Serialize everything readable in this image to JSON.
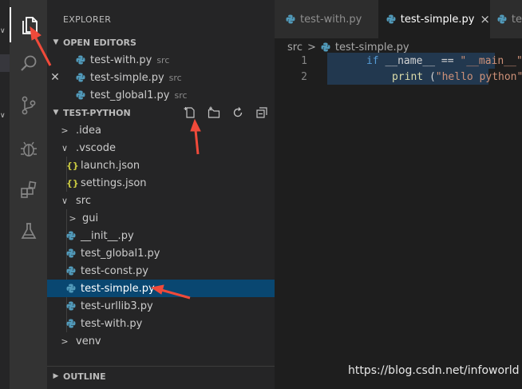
{
  "explorer": {
    "title": "EXPLORER",
    "open_editors": {
      "label": "OPEN EDITORS",
      "items": [
        {
          "name": "test-with.py",
          "folder": "src"
        },
        {
          "name": "test-simple.py",
          "folder": "src"
        },
        {
          "name": "test_global1.py",
          "folder": "src"
        }
      ]
    },
    "project": {
      "label": "TEST-PYTHON",
      "tree": {
        "idea": ".idea",
        "vscode": ".vscode",
        "launch": "launch.json",
        "settings": "settings.json",
        "src": "src",
        "gui": "gui",
        "init": "__init__.py",
        "global1": "test_global1.py",
        "const": "test-const.py",
        "simple": "test-simple.py",
        "urllib3": "test-urllib3.py",
        "with": "test-with.py",
        "venv": "venv"
      }
    },
    "outline": "OUTLINE"
  },
  "json_glyph": "{}",
  "tabs": [
    {
      "label": "test-with.py"
    },
    {
      "label": "test-simple.py",
      "close": "×"
    },
    {
      "label": "te"
    }
  ],
  "breadcrumb": {
    "folder": "src",
    "separator": ">",
    "file": "test-simple.py"
  },
  "code": {
    "line1_no": "1",
    "line2_no": "2",
    "l1_if": "if",
    "l1_name": "__name__",
    "l1_eq": "==",
    "l1_str": "\"__main__\"",
    "l1_colon": ":",
    "l2_print": "print",
    "l2_paren_open": "(",
    "l2_str": "\"hello python\"",
    "l2_paren_close": ")"
  },
  "watermark": "https://blog.csdn.net/infoworld",
  "colors": {
    "accent": "#094771",
    "arrow": "#f04a3a",
    "python": "#519aba",
    "json": "#cbcb41"
  }
}
